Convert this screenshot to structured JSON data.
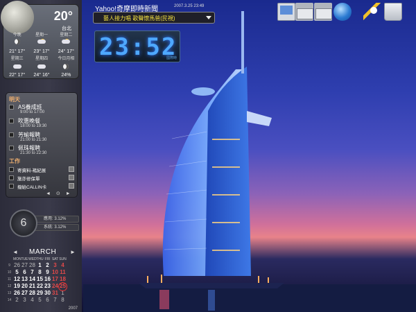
{
  "weather": {
    "current_temp": "20°",
    "city": "台北",
    "forecast": [
      {
        "day": "今晚",
        "icon": "moon-icon",
        "temps": ""
      },
      {
        "day": "星期一",
        "icon": "rain-icon",
        "temps": ""
      },
      {
        "day": "星期二",
        "icon": "rain-icon",
        "temps": ""
      },
      {
        "day": "",
        "icon": "",
        "temps": "21° 17°"
      },
      {
        "day": "",
        "icon": "",
        "temps": "23° 17°"
      },
      {
        "day": "",
        "icon": "",
        "temps": "24° 17°"
      },
      {
        "day": "星期三",
        "icon": "",
        "temps": ""
      },
      {
        "day": "星期四",
        "icon": "",
        "temps": ""
      },
      {
        "day": "今日月相",
        "icon": "",
        "temps": ""
      },
      {
        "day": "",
        "icon": "rain-icon",
        "temps": "22° 17°"
      },
      {
        "day": "",
        "icon": "rain-icon",
        "temps": "24° 16°"
      },
      {
        "day": "",
        "icon": "moon-icon",
        "temps": "24%"
      }
    ]
  },
  "todo": {
    "tomorrow_label": "明天",
    "items": [
      {
        "title": "AS養成班",
        "time": "9:00 to 17:00"
      },
      {
        "title": "吹惠晚餐",
        "time": "18:00 to 19:30"
      },
      {
        "title": "芳瑜報聘",
        "time": "21:00 to 21:30"
      },
      {
        "title": "佩珠報聘",
        "time": "21:30 to 22:30"
      }
    ],
    "work_label": "工作",
    "work_items": [
      "寄資料-褚紀展",
      "施亦修保單",
      "撥給CALLIN卡"
    ],
    "nav_prev": "◄",
    "nav_home": "⊙",
    "nav_next": "►"
  },
  "cpu": {
    "dial": "6",
    "app_label": "應用: 3.12%",
    "system_label": "系統: 3.12%"
  },
  "calendar": {
    "month": "MARCH",
    "prev": "◄",
    "next": "►",
    "year": "2007",
    "dow": [
      "MON",
      "TUE",
      "WED",
      "THU",
      "FRI",
      "SAT",
      "SUN"
    ],
    "weeks": [
      {
        "wk": "9",
        "days": [
          "26",
          "27",
          "28",
          "1",
          "2",
          "3",
          "4"
        ]
      },
      {
        "wk": "10",
        "days": [
          "5",
          "6",
          "7",
          "8",
          "9",
          "10",
          "11"
        ]
      },
      {
        "wk": "11",
        "days": [
          "12",
          "13",
          "14",
          "15",
          "16",
          "17",
          "18"
        ]
      },
      {
        "wk": "12",
        "days": [
          "19",
          "20",
          "21",
          "22",
          "23",
          "24",
          "25"
        ]
      },
      {
        "wk": "13",
        "days": [
          "26",
          "27",
          "28",
          "29",
          "30",
          "31",
          "1"
        ]
      },
      {
        "wk": "14",
        "days": [
          "2",
          "3",
          "4",
          "5",
          "6",
          "7",
          "8"
        ]
      }
    ],
    "today": "25"
  },
  "news": {
    "title": "Yahoo!奇摩即時新聞",
    "date": "2007.3.25 23:49",
    "headline": "藝人接力唱 歌聲懷馬爸(民視)"
  },
  "clock": {
    "time": "23:52",
    "tiny": "國際時"
  },
  "colors": {
    "news_headline": "#f3e040",
    "clock_digits": "#4ea8ff",
    "today_circle": "#e33333",
    "weekend_red": "#e34a4a"
  }
}
